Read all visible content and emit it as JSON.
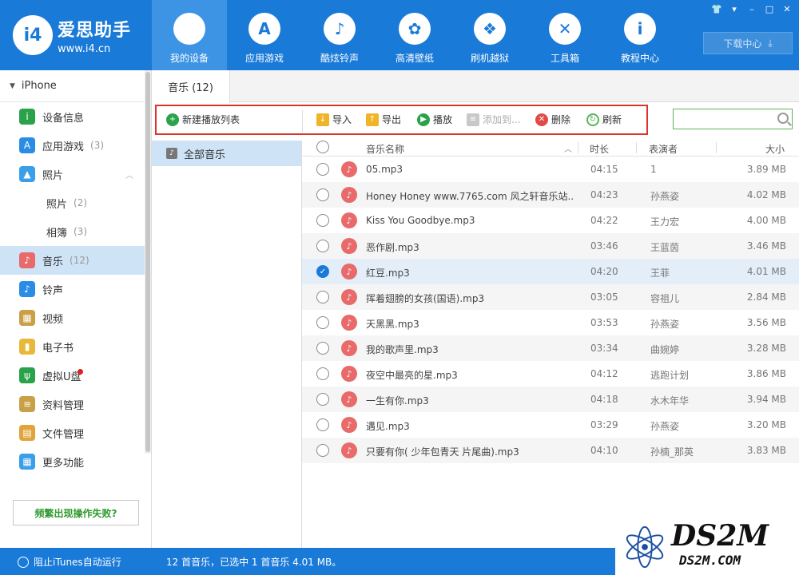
{
  "app": {
    "logo_name": "爱思助手",
    "logo_url": "www.i4.cn",
    "logo_mark": "i4"
  },
  "nav": [
    {
      "label": "我的设备",
      "icon": "apple-icon",
      "glyph": "",
      "active": true
    },
    {
      "label": "应用游戏",
      "icon": "app-store-icon",
      "glyph": "A"
    },
    {
      "label": "酷炫铃声",
      "icon": "bell-icon",
      "glyph": "♪"
    },
    {
      "label": "高清壁纸",
      "icon": "flower-icon",
      "glyph": "✿"
    },
    {
      "label": "刷机越狱",
      "icon": "box-icon",
      "glyph": "❖"
    },
    {
      "label": "工具箱",
      "icon": "tools-icon",
      "glyph": "✕"
    },
    {
      "label": "教程中心",
      "icon": "info-icon",
      "glyph": "i"
    }
  ],
  "window_controls": [
    "👕",
    "▾",
    "–",
    "□",
    "✕"
  ],
  "download": {
    "label": "下载中心",
    "icon": "⤓"
  },
  "sidebar": {
    "device": "iPhone",
    "items": [
      {
        "label": "设备信息",
        "icon": "info-circle-icon",
        "color": "#2aa24a",
        "glyph": "i"
      },
      {
        "label": "应用游戏",
        "count": "(3)",
        "icon": "app-store-icon",
        "color": "#2b8ce6",
        "glyph": "A"
      },
      {
        "label": "照片",
        "icon": "photo-icon",
        "color": "#3a9ee8",
        "glyph": "▲",
        "arrow": "︿"
      },
      {
        "label": "照片",
        "count": "(2)",
        "sub": true
      },
      {
        "label": "相簿",
        "count": "(3)",
        "sub": true
      },
      {
        "label": "音乐",
        "count": "(12)",
        "icon": "music-icon",
        "color": "#e86a6a",
        "glyph": "♪",
        "active": true
      },
      {
        "label": "铃声",
        "icon": "bell-icon",
        "color": "#2b8ce6",
        "glyph": "♪"
      },
      {
        "label": "视频",
        "icon": "video-icon",
        "color": "#c9a046",
        "glyph": "▦"
      },
      {
        "label": "电子书",
        "icon": "book-icon",
        "color": "#e8b83a",
        "glyph": "▮"
      },
      {
        "label": "虚拟U盘",
        "icon": "usb-icon",
        "color": "#2aa24a",
        "glyph": "ψ",
        "dot": true
      },
      {
        "label": "资料管理",
        "icon": "contacts-icon",
        "color": "#c9a046",
        "glyph": "≡"
      },
      {
        "label": "文件管理",
        "icon": "file-icon",
        "color": "#e0a53a",
        "glyph": "▤"
      },
      {
        "label": "更多功能",
        "icon": "grid-icon",
        "color": "#3a9ee8",
        "glyph": "▦"
      }
    ],
    "fail_button": "频繁出现操作失败?"
  },
  "tab": "音乐 (12)",
  "toolbar": {
    "new_playlist": "新建播放列表",
    "import": "导入",
    "export": "导出",
    "play": "播放",
    "add_to": "添加到...",
    "delete": "删除",
    "refresh": "刷新",
    "search_placeholder": ""
  },
  "playlist": {
    "all_music": "全部音乐"
  },
  "table": {
    "headers": {
      "name": "音乐名称",
      "duration": "时长",
      "artist": "表演者",
      "size": "大小"
    },
    "rows": [
      {
        "name": "05.mp3",
        "duration": "04:15",
        "artist": "1",
        "size": "3.89 MB",
        "checked": false
      },
      {
        "name": "Honey Honey www.7765.com 风之轩音乐站...",
        "duration": "04:23",
        "artist": "孙燕姿",
        "size": "4.02 MB",
        "checked": false
      },
      {
        "name": "Kiss You Goodbye.mp3",
        "duration": "04:22",
        "artist": "王力宏",
        "size": "4.00 MB",
        "checked": false
      },
      {
        "name": "恶作剧.mp3",
        "duration": "03:46",
        "artist": "王蓝茵",
        "size": "3.46 MB",
        "checked": false
      },
      {
        "name": "红豆.mp3",
        "duration": "04:20",
        "artist": "王菲",
        "size": "4.01 MB",
        "checked": true
      },
      {
        "name": "挥着翅膀的女孩(国语).mp3",
        "duration": "03:05",
        "artist": "容祖儿",
        "size": "2.84 MB",
        "checked": false
      },
      {
        "name": "天黑黑.mp3",
        "duration": "03:53",
        "artist": "孙燕姿",
        "size": "3.56 MB",
        "checked": false
      },
      {
        "name": "我的歌声里.mp3",
        "duration": "03:34",
        "artist": "曲婉婷",
        "size": "3.28 MB",
        "checked": false
      },
      {
        "name": "夜空中最亮的星.mp3",
        "duration": "04:12",
        "artist": "逃跑计划",
        "size": "3.86 MB",
        "checked": false
      },
      {
        "name": "一生有你.mp3",
        "duration": "04:18",
        "artist": "水木年华",
        "size": "3.94 MB",
        "checked": false
      },
      {
        "name": "遇见.mp3",
        "duration": "03:29",
        "artist": "孙燕姿",
        "size": "3.20 MB",
        "checked": false
      },
      {
        "name": "只要有你( 少年包青天 片尾曲).mp3",
        "duration": "04:10",
        "artist": "孙楠_那英",
        "size": "3.83 MB",
        "checked": false
      }
    ]
  },
  "status": {
    "itunes": "阻止iTunes自动运行",
    "summary": "12 首音乐，已选中 1 首音乐 4.01 MB。"
  },
  "watermark": {
    "main": "DS2M",
    "sub": "DS2M.COM"
  }
}
